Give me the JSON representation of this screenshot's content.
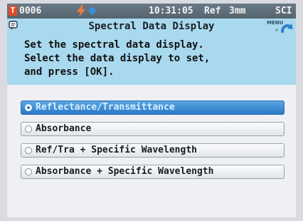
{
  "status_bar": {
    "t_badge": "T",
    "sample_number": "0006",
    "time": "10:31:05",
    "mode": "Ref",
    "aperture": "3mm",
    "spec": "SCI"
  },
  "header": {
    "title": "Spectral Data Display",
    "menu_label": "MENU"
  },
  "instructions": [
    "Set the spectral data display.",
    "Select the data display to set,",
    "and press [OK]."
  ],
  "options": [
    {
      "label": "Reflectance/Transmittance"
    },
    {
      "label": "Absorbance"
    },
    {
      "label": "Ref/Tra + Specific Wavelength"
    },
    {
      "label": "Absorbance + Specific Wavelength"
    }
  ],
  "selected_index": 0,
  "colors": {
    "status_bar": "#55646f",
    "header_bg": "#a9d9ee",
    "selected_option": "#2b78c5",
    "badge": "#e34a2a",
    "bolt": "#f07a3a",
    "diamond": "#3d8fd8"
  }
}
